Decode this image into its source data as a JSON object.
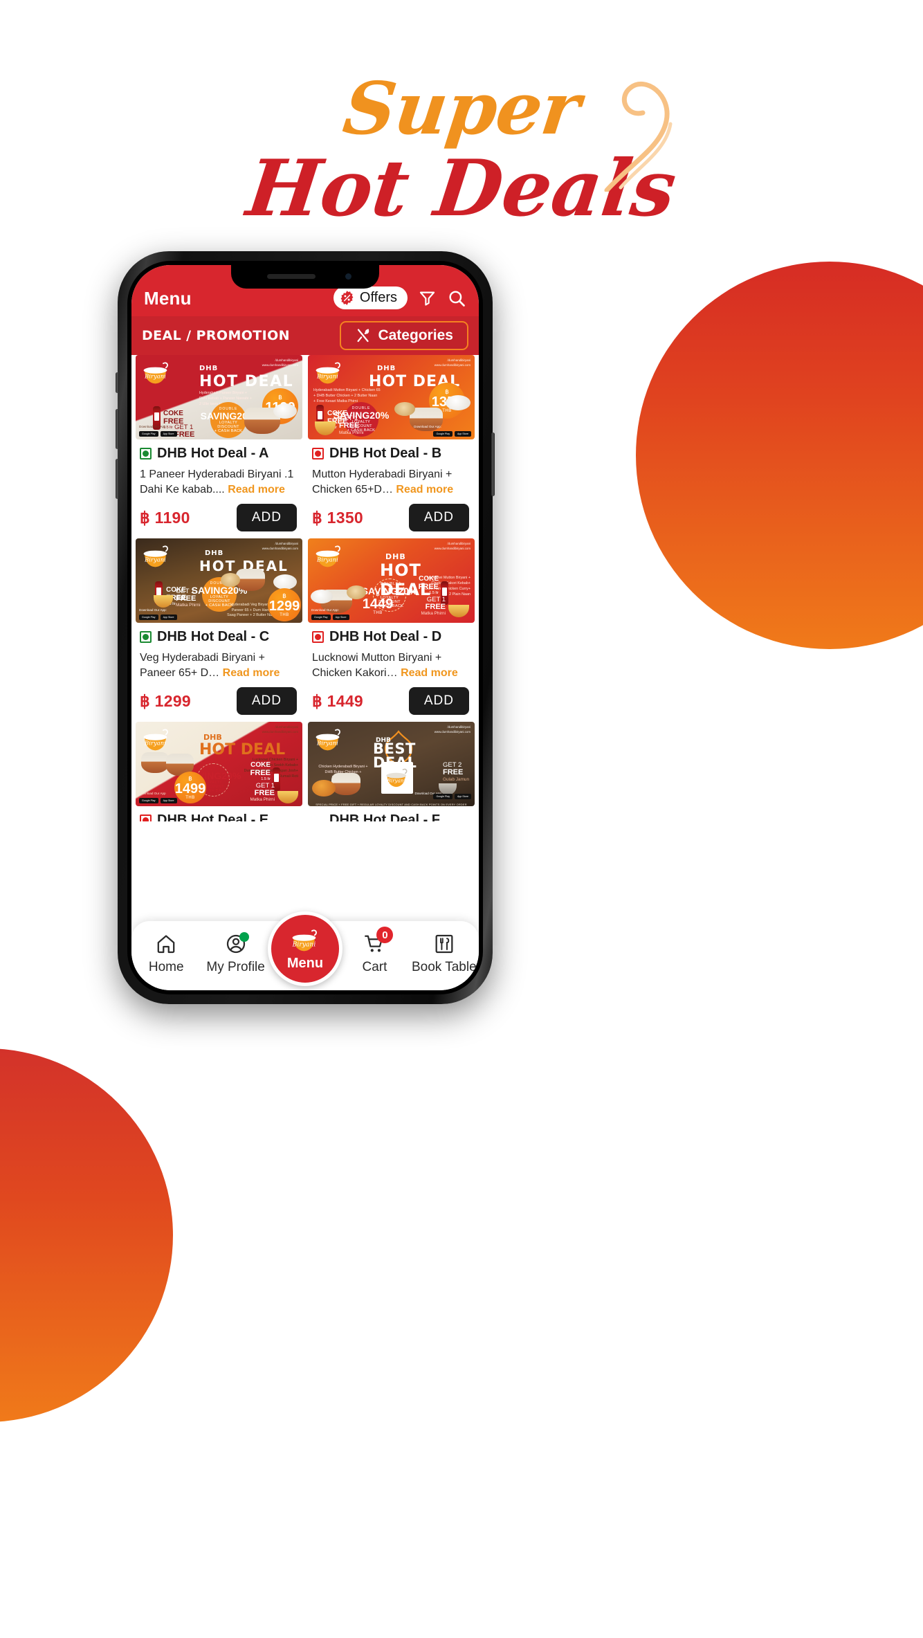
{
  "hero": {
    "line1": "Super",
    "line2": "Hot Deals",
    "colors": {
      "line1": "#F0921F",
      "line2": "#CE2027"
    }
  },
  "decor": {
    "blob_right_name": "gradient-circle-right",
    "blob_left_name": "gradient-circle-left",
    "gradient_from": "#D62C24",
    "gradient_to": "#F07A1A"
  },
  "app": {
    "header": {
      "title": "Menu",
      "offers_label": "Offers",
      "offers_icon": "percent-badge-icon",
      "filter_icon": "filter-icon",
      "search_icon": "search-icon",
      "background": "#D8262E"
    },
    "subheader": {
      "title": "DEAL / PROMOTION",
      "categories_label": "Categories",
      "categories_icon": "fork-knife-icon",
      "border_color": "#F58220"
    },
    "currency": "฿",
    "read_more_label": "Read more",
    "add_label": "ADD",
    "items": [
      {
        "id": "deal-a",
        "title": "DHB Hot Deal - A",
        "diet": "veg",
        "description": "1 Paneer Hyderabadi Biryani .1 Dahi Ke kabab....",
        "price": "1190",
        "banner": {
          "brand": "DHB",
          "headline": "HOT DEAL",
          "theme": "red",
          "lines": [
            "Hyderabadi Paneer Biryani +",
            "Dahi Kebab + Paneer Nawabi +",
            "2 Ulte tawa ka paratha"
          ],
          "badge_value": "1190",
          "badge_currency": "THB",
          "saving_top": "DOUBLE",
          "saving_value": "SAVING20%",
          "saving_l1": "LOYALTY DISCOUNT",
          "saving_l2": "+ CASH BACK",
          "coke_l1": "COKE",
          "coke_l2": "FREE",
          "coke_l3": "1.5 ltr",
          "free_l1": "GET 1",
          "free_l2": "FREE",
          "free_l3": "Double Ka Meetha",
          "social": "/dumhandibiryani",
          "website": "www.dumhandibiryani.com",
          "download_label": "Download Our App:",
          "store1": "Google Play",
          "store2": "App Store"
        }
      },
      {
        "id": "deal-b",
        "title": "DHB Hot Deal - B",
        "diet": "nonveg",
        "description": "Mutton Hyderabadi Biryani + Chicken 65+D…",
        "price": "1350",
        "banner": {
          "brand": "DHB",
          "headline": "HOT DEAL",
          "theme": "orange",
          "lines": [
            "Hyderabadi Mutton Biryani + Chicken 65",
            "+ DHB Butter Chicken + 2 Butter Naan",
            "+ Free Kesari Matka Phirni"
          ],
          "badge_value": "1350",
          "badge_currency": "THB",
          "saving_top": "DOUBLE",
          "saving_value": "SAVING20%",
          "saving_l1": "LOYALTY DISCOUNT",
          "saving_l2": "+ CASH BACK",
          "coke_l1": "COKE",
          "coke_l2": "FREE",
          "coke_l3": "1.5 ltr",
          "free_l1": "GET 1",
          "free_l2": "FREE",
          "free_l3": "Matka Phirni",
          "social": "/dumhandibiryani",
          "website": "www.dumhandibiryani.com",
          "download_label": "Download Our App:",
          "store1": "Google Play",
          "store2": "App Store"
        }
      },
      {
        "id": "deal-c",
        "title": "DHB Hot Deal - C",
        "diet": "veg",
        "description": "Veg Hyderabadi Biryani + Paneer 65+ D…",
        "price": "1299",
        "banner": {
          "brand": "DHB",
          "headline": "HOT  DEAL",
          "theme": "brown",
          "lines": [
            "Hyderabadi Veg Biryani +",
            "Paneer 65 + Dum Handi",
            "Saag Paneer + 2 Butter Naan"
          ],
          "badge_value": "1299",
          "badge_currency": "THB",
          "saving_top": "DOUBLE",
          "saving_value": "SAVING20%",
          "saving_l1": "LOYALTY DISCOUNT",
          "saving_l2": "+ CASH BACK",
          "coke_l1": "COKE",
          "coke_l2": "FREE",
          "coke_l3": "1.5 ltr",
          "free_l1": "GET 1",
          "free_l2": "FREE",
          "free_l3": "Matka Phirni",
          "social": "/dumhandibiryani",
          "website": "www.dumhandibiryani.com",
          "download_label": "Download Our App:",
          "store1": "Google Play",
          "store2": "App Store"
        }
      },
      {
        "id": "deal-d",
        "title": "DHB Hot Deal - D",
        "diet": "nonveg",
        "description": "Lucknowi Mutton Biryani + Chicken Kakori…",
        "price": "1449",
        "banner": {
          "brand": "DHB",
          "headline": "HOT DEAL",
          "theme": "orangered",
          "lines": [
            "Lucknowi Mutton Biryani +",
            "Chicken Kakori Kebab+",
            "Dum Handi Chicken Curry+",
            "2 Plain Naan"
          ],
          "badge_value": "1449",
          "badge_currency": "THB",
          "saving_top": "DOUBLE",
          "saving_value": "SAVING20%",
          "saving_l1": "LOYALTY DISCOUNT",
          "saving_l2": "+ CASH BACK",
          "coke_l1": "COKE",
          "coke_l2": "FREE",
          "coke_l3": "1.5 ltr",
          "free_l1": "GET 1",
          "free_l2": "FREE",
          "free_l3": "Matka Phirni",
          "social": "/dumhandibiryani",
          "website": "www.dumhandibiryani.com",
          "download_label": "Download Our App:",
          "store1": "Google Play",
          "store2": "App Store"
        }
      },
      {
        "id": "deal-e",
        "title": "DHB Hot Deal - E",
        "diet": "nonveg",
        "description": "",
        "price": "",
        "banner": {
          "brand": "DHB",
          "headline": "HOT DEAL",
          "theme": "cream",
          "lines": [
            "Lucknowi Chicken Biryani +",
            "Mutton Seekh Kebab+",
            "Dum Handi Mutton Rogan Josh+",
            "2 Rumali Roti"
          ],
          "badge_value": "1499",
          "badge_currency": "THB",
          "saving_top": "DOUBLE",
          "saving_value": "SAVING20%",
          "saving_l1": "LOYALTY DISCOUNT",
          "saving_l2": "+ CASH BACK",
          "coke_l1": "COKE",
          "coke_l2": "FREE",
          "coke_l3": "1.5 ltr",
          "free_l1": "GET 1",
          "free_l2": "FREE",
          "free_l3": "Matka Phirni",
          "social": "/dumhandibiryani",
          "website": "www.dumhandibiryani.com",
          "download_label": "Download Our App",
          "store1": "Google Play",
          "store2": "App Store"
        }
      },
      {
        "id": "deal-f",
        "title": "DHB Hot Deal - F",
        "diet": "nonveg",
        "description": "",
        "price": "",
        "banner": {
          "brand": "DHB",
          "headline": "BEST DEAL",
          "theme": "dark",
          "lines": [
            "Chicken Hyderabadi Biryani +",
            "DHB Butter Chicken +",
            "2 Butter Naan"
          ],
          "badge_value": "",
          "badge_currency": "",
          "saving_top": "",
          "saving_value": "",
          "saving_l1": "",
          "saving_l2": "",
          "coke_l1": "",
          "coke_l2": "",
          "coke_l3": "",
          "free_l1": "GET 2",
          "free_l2": "FREE",
          "free_l3": "Gulab Jamun",
          "social": "/dumhandibiryani",
          "website": "www.dumhandibiryani.com",
          "download_label": "Download Our App",
          "store1": "Google Play",
          "store2": "App Store",
          "footer": "SPECIAL PRICE + FREE GIFT + REGULAR LOYALTY DISCOUNT AND CASH BACK POINTS ON EVERY ORDER"
        }
      }
    ],
    "bottom_nav": {
      "items": [
        {
          "label": "Home",
          "icon": "home-icon"
        },
        {
          "label": "My Profile",
          "icon": "profile-icon"
        },
        {
          "label": "Cart",
          "icon": "cart-icon",
          "badge": "0"
        },
        {
          "label": "Book Table",
          "icon": "cutlery-icon"
        }
      ],
      "center": {
        "label": "Menu",
        "icon": "biryani-pot-logo"
      }
    }
  }
}
